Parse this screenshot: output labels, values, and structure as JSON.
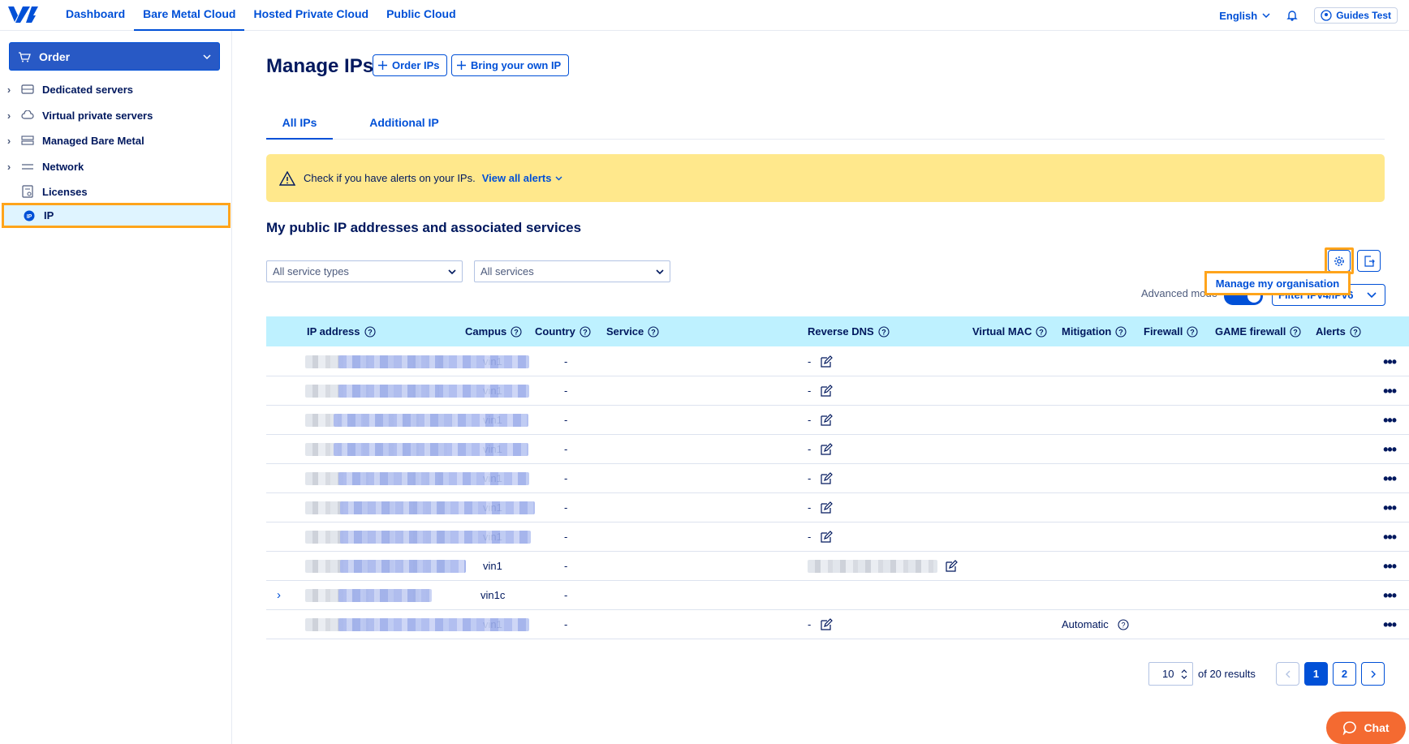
{
  "nav": {
    "links": [
      "Dashboard",
      "Bare Metal Cloud",
      "Hosted Private Cloud",
      "Public Cloud"
    ],
    "active": "Bare Metal Cloud",
    "language": "English",
    "user": "Guides Test"
  },
  "sidebar": {
    "order_label": "Order",
    "items": [
      {
        "label": "Dedicated servers",
        "icon": "server-icon",
        "expandable": true
      },
      {
        "label": "Virtual private servers",
        "icon": "cloud-icon",
        "expandable": true
      },
      {
        "label": "Managed Bare Metal",
        "icon": "stack-icon",
        "expandable": true
      },
      {
        "label": "Network",
        "icon": "network-icon",
        "expandable": true
      },
      {
        "label": "Licenses",
        "icon": "license-icon",
        "expandable": false
      },
      {
        "label": "IP",
        "icon": "ip-icon",
        "expandable": false,
        "active": true
      }
    ]
  },
  "page": {
    "title": "Manage IPs",
    "order_ips": "Order IPs",
    "byoip": "Bring your own IP",
    "tabs": [
      "All IPs",
      "Additional IP"
    ],
    "active_tab": "All IPs",
    "alert_text": "Check if you have alerts on your IPs.",
    "alert_link": "View all alerts",
    "section_title": "My public IP addresses and associated services",
    "filter_service_types": "All service types",
    "filter_services": "All services",
    "manage_org": "Manage my organisation",
    "advanced_mode": "Advanced mode",
    "filter_ip": "Filter IPv4/IPv6"
  },
  "table": {
    "columns": [
      "IP address",
      "Campus",
      "Country",
      "Service",
      "Reverse DNS",
      "Virtual MAC",
      "Mitigation",
      "Firewall",
      "GAME firewall",
      "Alerts"
    ],
    "rows": [
      {
        "campus": "vin1",
        "country": "-",
        "rdns": "-",
        "mitigation": ""
      },
      {
        "campus": "vin1",
        "country": "-",
        "rdns": "-",
        "mitigation": ""
      },
      {
        "campus": "vin1",
        "country": "-",
        "rdns": "-",
        "mitigation": ""
      },
      {
        "campus": "vin1",
        "country": "-",
        "rdns": "-",
        "mitigation": ""
      },
      {
        "campus": "vin1",
        "country": "-",
        "rdns": "-",
        "mitigation": ""
      },
      {
        "campus": "vin1",
        "country": "-",
        "rdns": "-",
        "mitigation": ""
      },
      {
        "campus": "vin1",
        "country": "-",
        "rdns": "-",
        "mitigation": ""
      },
      {
        "campus": "vin1",
        "country": "-",
        "rdns": "",
        "mitigation": ""
      },
      {
        "campus": "vin1c",
        "country": "-",
        "rdns": "",
        "mitigation": ""
      },
      {
        "campus": "vin1",
        "country": "-",
        "rdns": "-",
        "mitigation": "Automatic"
      }
    ]
  },
  "pagination": {
    "per_page": "10",
    "results": "of 20 results",
    "pages": [
      "1",
      "2"
    ],
    "current": "1"
  },
  "chat_label": "Chat",
  "colors": {
    "primary": "#0050d7",
    "highlight": "#ffa41b",
    "alert_bg": "#ffe88c",
    "table_head": "#bef1ff",
    "chat": "#f46a31"
  }
}
